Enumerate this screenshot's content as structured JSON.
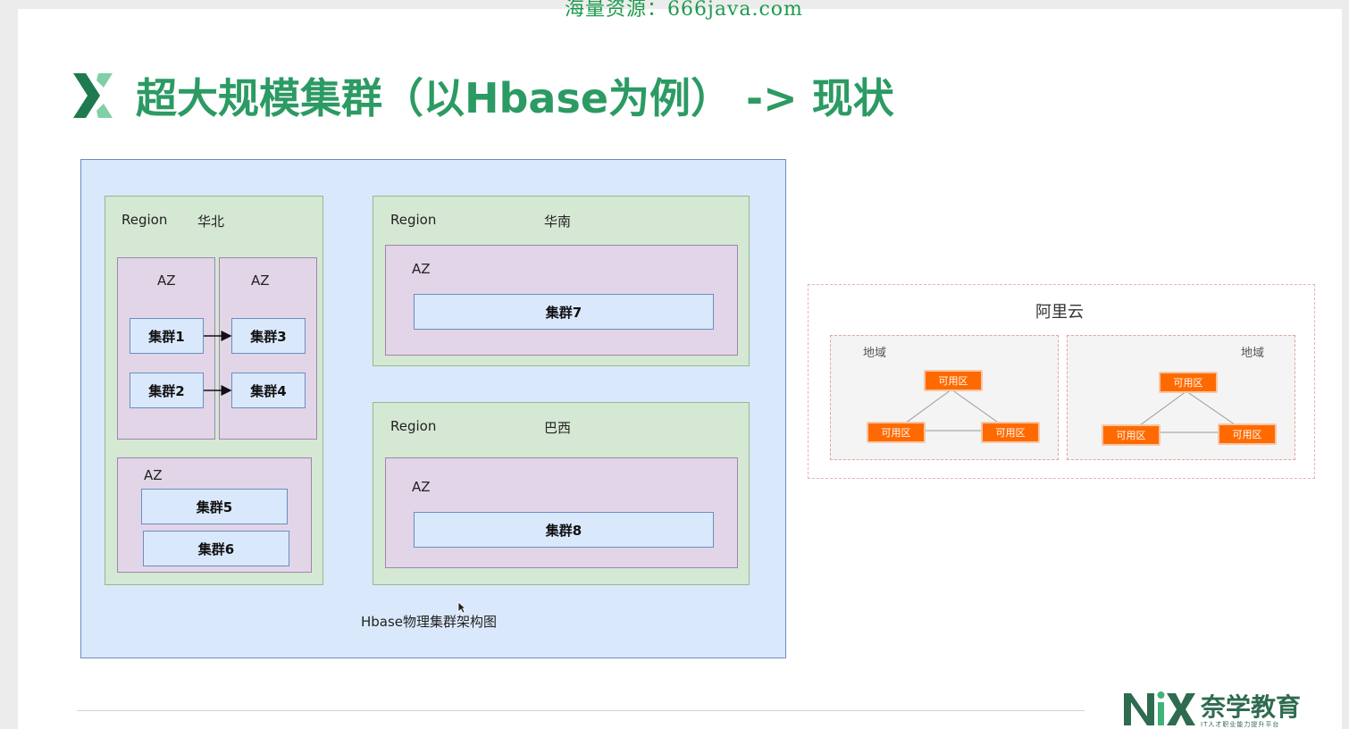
{
  "watermark": "海量资源：666java.com",
  "title": "超大规模集群（以Hbase为例） -> 现状",
  "diagram": {
    "caption": "Hbase物理集群架构图",
    "regions": [
      {
        "label": "Region",
        "name": "华北",
        "azs": [
          {
            "label": "AZ",
            "clusters": [
              "集群1",
              "集群2"
            ]
          },
          {
            "label": "AZ",
            "clusters": [
              "集群3",
              "集群4"
            ]
          },
          {
            "label": "AZ",
            "clusters": [
              "集群5",
              "集群6"
            ]
          }
        ]
      },
      {
        "label": "Region",
        "name": "华南",
        "azs": [
          {
            "label": "AZ",
            "clusters": [
              "集群7"
            ]
          }
        ]
      },
      {
        "label": "Region",
        "name": "巴西",
        "azs": [
          {
            "label": "AZ",
            "clusters": [
              "集群8"
            ]
          }
        ]
      }
    ]
  },
  "aliyun": {
    "title": "阿里云",
    "domains": [
      {
        "label": "地域",
        "zones": [
          "可用区",
          "可用区",
          "可用区"
        ]
      },
      {
        "label": "地域",
        "zones": [
          "可用区",
          "可用区",
          "可用区"
        ]
      }
    ]
  },
  "brand": {
    "name": "奈学教育",
    "tagline": "IT人才职业能力提升平台",
    "accent": "#2c9a63"
  }
}
